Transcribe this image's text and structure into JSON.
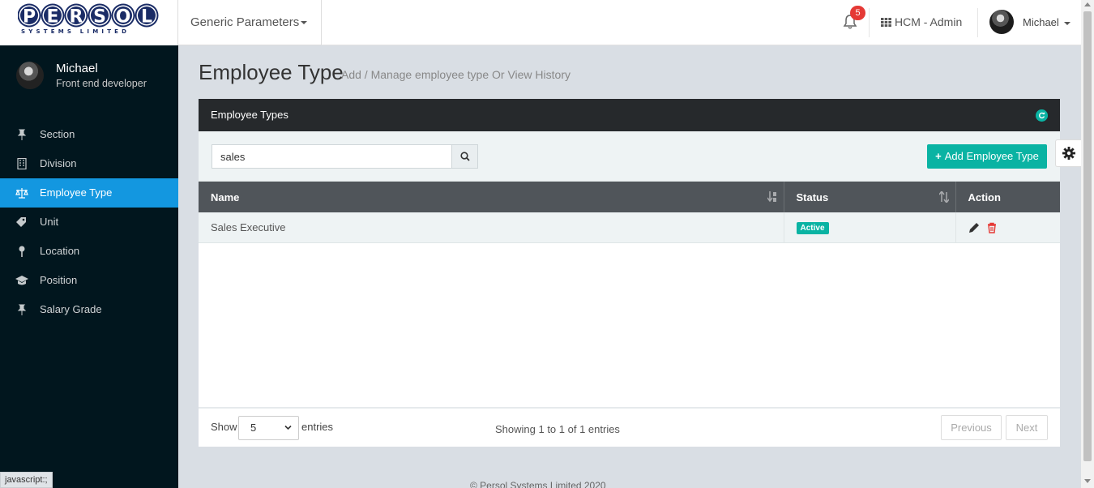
{
  "brand": {
    "logo_text": "PERSOL",
    "logo_subtext": "SYSTEMS LIMITED"
  },
  "header": {
    "module_dropdown": "Generic Parameters",
    "notifications_count": "5",
    "app_label": "HCM - Admin",
    "user_name": "Michael"
  },
  "sidebar": {
    "user": {
      "name": "Michael",
      "role": "Front end developer"
    },
    "items": [
      {
        "label": "Section",
        "icon": "pin-icon",
        "active": false
      },
      {
        "label": "Division",
        "icon": "building-icon",
        "active": false
      },
      {
        "label": "Employee Type",
        "icon": "balance-scale-icon",
        "active": true
      },
      {
        "label": "Unit",
        "icon": "tag-icon",
        "active": false
      },
      {
        "label": "Location",
        "icon": "map-pin-icon",
        "active": false
      },
      {
        "label": "Position",
        "icon": "graduation-cap-icon",
        "active": false
      },
      {
        "label": "Salary Grade",
        "icon": "pin-icon",
        "active": false
      }
    ]
  },
  "page": {
    "title": "Employee Type",
    "subtitle": "Add / Manage employee type Or View History"
  },
  "panel": {
    "title": "Employee Types",
    "search_value": "sales",
    "add_button_label": "Add Employee Type",
    "columns": [
      "Name",
      "Status",
      "Action"
    ],
    "rows": [
      {
        "name": "Sales Executive",
        "status": "Active"
      }
    ],
    "footer": {
      "show_label": "Show",
      "page_size": "5",
      "entries_label": "entries",
      "showing_text": "Showing 1 to 1 of 1 entries",
      "previous_label": "Previous",
      "next_label": "Next"
    }
  },
  "footer": {
    "copyright": "© Persol Systems Limited 2020"
  },
  "status_tooltip": "javascript:;",
  "colors": {
    "accent_teal": "#0ab3a3",
    "sidebar_active": "#1397e0",
    "sidebar_bg": "#01161e",
    "badge_red": "#e53935"
  }
}
